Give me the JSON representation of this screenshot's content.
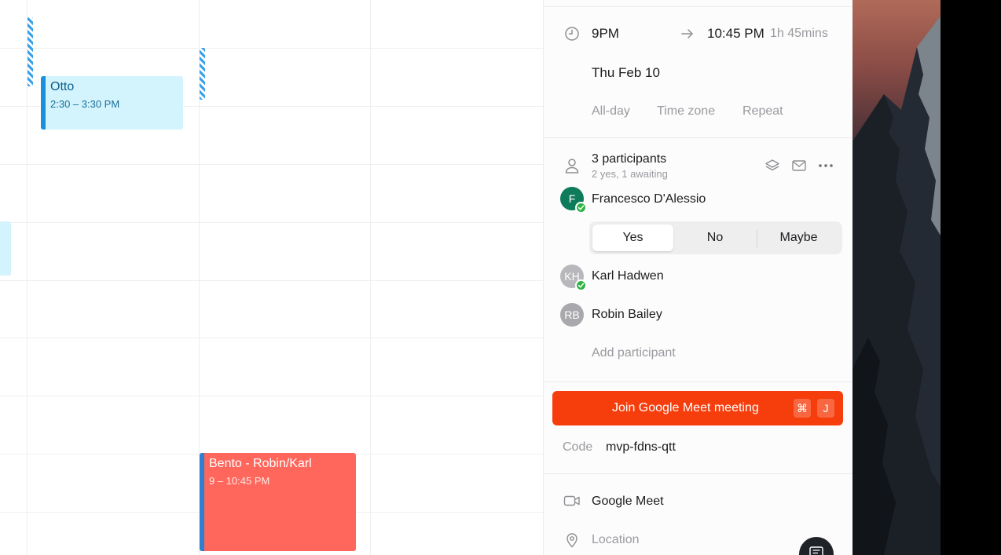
{
  "calendar": {
    "events": [
      {
        "title": "Otto",
        "time": "2:30 – 3:30 PM",
        "color": "#d3f3fd",
        "accent": "#1a8fdc"
      },
      {
        "title": "Bento - Robin/Karl",
        "time": "9 – 10:45 PM",
        "color": "#ff675c",
        "accent": "#2f7fd0"
      }
    ]
  },
  "detail": {
    "start_time": "9PM",
    "end_time": "10:45 PM",
    "duration": "1h 45mins",
    "date": "Thu Feb 10",
    "options": {
      "allday": "All-day",
      "timezone": "Time zone",
      "repeat": "Repeat"
    },
    "participants": {
      "title": "3 participants",
      "summary": "2 yes, 1 awaiting",
      "list": [
        {
          "initials": "F",
          "name": "Francesco D'Alessio",
          "accepted": true,
          "avatar_color": "#0e7c5a"
        },
        {
          "initials": "KH",
          "name": "Karl Hadwen",
          "accepted": true,
          "avatar_color": "#b8b8bc"
        },
        {
          "initials": "RB",
          "name": "Robin Bailey",
          "accepted": false,
          "avatar_color": "#a9a9ad"
        }
      ],
      "add_placeholder": "Add participant"
    },
    "rsvp": {
      "yes": "Yes",
      "no": "No",
      "maybe": "Maybe",
      "selected": "Yes"
    },
    "join_button": {
      "label": "Join Google Meet meeting",
      "key1": "⌘",
      "key2": "J",
      "color": "#f63d0c"
    },
    "code": {
      "label": "Code",
      "value": "mvp-fdns-qtt"
    },
    "conferencing": "Google Meet",
    "location_placeholder": "Location"
  }
}
